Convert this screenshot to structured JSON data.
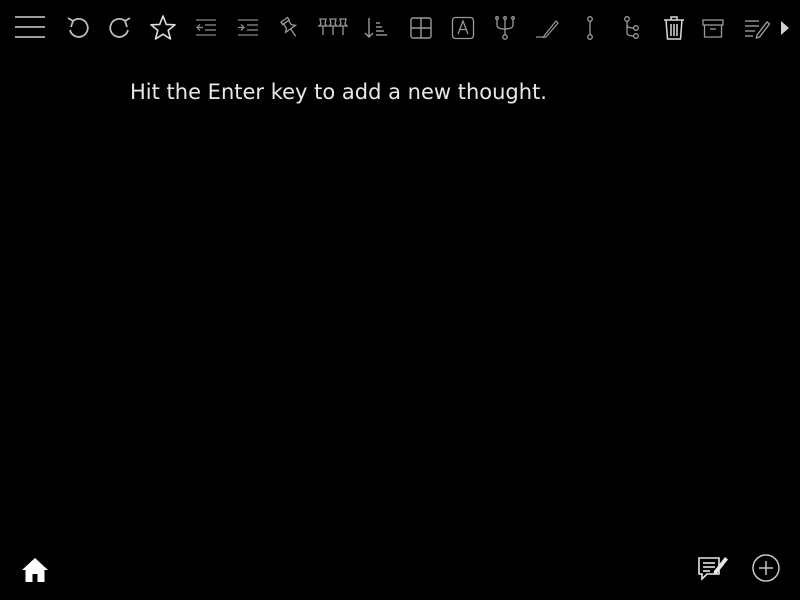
{
  "editor": {
    "placeholder": "Hit the Enter key to add a new thought."
  },
  "toolbar": {
    "menu_icon": "hamburger-menu-icon",
    "tools": [
      {
        "name": "undo",
        "icon": "undo-icon"
      },
      {
        "name": "redo",
        "icon": "redo-icon"
      },
      {
        "name": "favorite",
        "icon": "star-icon"
      },
      {
        "name": "outdent",
        "icon": "outdent-icon"
      },
      {
        "name": "indent",
        "icon": "indent-icon"
      },
      {
        "name": "pin",
        "icon": "pin-icon"
      },
      {
        "name": "pin-all",
        "icon": "pin-all-icon"
      },
      {
        "name": "sort",
        "icon": "sort-icon"
      },
      {
        "name": "table-view",
        "icon": "grid-icon"
      },
      {
        "name": "text-format",
        "icon": "letter-a-icon"
      },
      {
        "name": "subcategorize",
        "icon": "branch-icon"
      },
      {
        "name": "edit",
        "icon": "pencil-line-icon"
      },
      {
        "name": "split",
        "icon": "vertical-link-icon"
      },
      {
        "name": "categorize",
        "icon": "tree-icon"
      },
      {
        "name": "delete",
        "icon": "trash-icon"
      },
      {
        "name": "archive",
        "icon": "archive-box-icon"
      },
      {
        "name": "note",
        "icon": "note-edit-icon"
      }
    ],
    "more_icon": "caret-right-icon"
  },
  "footer": {
    "home_icon": "home-icon",
    "notes_icon": "notes-edit-icon",
    "add_icon": "plus-circle-icon"
  },
  "colors": {
    "background": "#000000",
    "foreground": "#e8e8e8",
    "icon": "#bfbfbf"
  }
}
